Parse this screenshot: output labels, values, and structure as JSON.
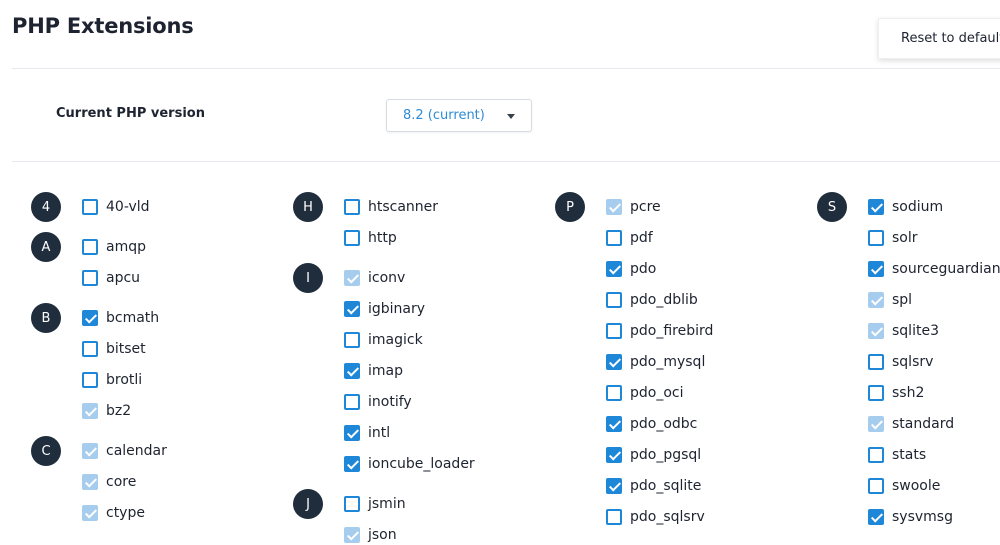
{
  "header": {
    "title": "PHP Extensions",
    "reset_label": "Reset to default"
  },
  "version": {
    "label": "Current PHP version",
    "selected": "8.2 (current)"
  },
  "columns": [
    {
      "groups": [
        {
          "letter": "4",
          "items": [
            {
              "name": "40-vld",
              "checked": false,
              "disabled": false
            }
          ]
        },
        {
          "letter": "A",
          "items": [
            {
              "name": "amqp",
              "checked": false,
              "disabled": false
            },
            {
              "name": "apcu",
              "checked": false,
              "disabled": false
            }
          ]
        },
        {
          "letter": "B",
          "items": [
            {
              "name": "bcmath",
              "checked": true,
              "disabled": false
            },
            {
              "name": "bitset",
              "checked": false,
              "disabled": false
            },
            {
              "name": "brotli",
              "checked": false,
              "disabled": false
            },
            {
              "name": "bz2",
              "checked": true,
              "disabled": true
            }
          ]
        },
        {
          "letter": "C",
          "items": [
            {
              "name": "calendar",
              "checked": true,
              "disabled": true
            },
            {
              "name": "core",
              "checked": true,
              "disabled": true
            },
            {
              "name": "ctype",
              "checked": true,
              "disabled": true
            }
          ]
        }
      ]
    },
    {
      "groups": [
        {
          "letter": "H",
          "items": [
            {
              "name": "htscanner",
              "checked": false,
              "disabled": false
            },
            {
              "name": "http",
              "checked": false,
              "disabled": false
            }
          ]
        },
        {
          "letter": "I",
          "items": [
            {
              "name": "iconv",
              "checked": true,
              "disabled": true
            },
            {
              "name": "igbinary",
              "checked": true,
              "disabled": false
            },
            {
              "name": "imagick",
              "checked": false,
              "disabled": false
            },
            {
              "name": "imap",
              "checked": true,
              "disabled": false
            },
            {
              "name": "inotify",
              "checked": false,
              "disabled": false
            },
            {
              "name": "intl",
              "checked": true,
              "disabled": false
            },
            {
              "name": "ioncube_loader",
              "checked": true,
              "disabled": false
            }
          ]
        },
        {
          "letter": "J",
          "items": [
            {
              "name": "jsmin",
              "checked": false,
              "disabled": false
            },
            {
              "name": "json",
              "checked": true,
              "disabled": true
            }
          ]
        }
      ]
    },
    {
      "groups": [
        {
          "letter": "P",
          "items": [
            {
              "name": "pcre",
              "checked": true,
              "disabled": true
            },
            {
              "name": "pdf",
              "checked": false,
              "disabled": false
            },
            {
              "name": "pdo",
              "checked": true,
              "disabled": false
            },
            {
              "name": "pdo_dblib",
              "checked": false,
              "disabled": false
            },
            {
              "name": "pdo_firebird",
              "checked": false,
              "disabled": false
            },
            {
              "name": "pdo_mysql",
              "checked": true,
              "disabled": false
            },
            {
              "name": "pdo_oci",
              "checked": false,
              "disabled": false
            },
            {
              "name": "pdo_odbc",
              "checked": true,
              "disabled": false
            },
            {
              "name": "pdo_pgsql",
              "checked": true,
              "disabled": false
            },
            {
              "name": "pdo_sqlite",
              "checked": true,
              "disabled": false
            },
            {
              "name": "pdo_sqlsrv",
              "checked": false,
              "disabled": false
            }
          ]
        }
      ]
    },
    {
      "groups": [
        {
          "letter": "S",
          "items": [
            {
              "name": "sodium",
              "checked": true,
              "disabled": false
            },
            {
              "name": "solr",
              "checked": false,
              "disabled": false
            },
            {
              "name": "sourceguardian",
              "checked": true,
              "disabled": false
            },
            {
              "name": "spl",
              "checked": true,
              "disabled": true
            },
            {
              "name": "sqlite3",
              "checked": true,
              "disabled": true
            },
            {
              "name": "sqlsrv",
              "checked": false,
              "disabled": false
            },
            {
              "name": "ssh2",
              "checked": false,
              "disabled": false
            },
            {
              "name": "standard",
              "checked": true,
              "disabled": true
            },
            {
              "name": "stats",
              "checked": false,
              "disabled": false
            },
            {
              "name": "swoole",
              "checked": false,
              "disabled": false
            },
            {
              "name": "sysvmsg",
              "checked": true,
              "disabled": false
            }
          ]
        }
      ]
    }
  ],
  "colors": {
    "accent": "#1e87d8",
    "disabled_check": "#a6cdee",
    "letter_badge": "#1f2d3d",
    "select_text": "#2e8cd6"
  }
}
